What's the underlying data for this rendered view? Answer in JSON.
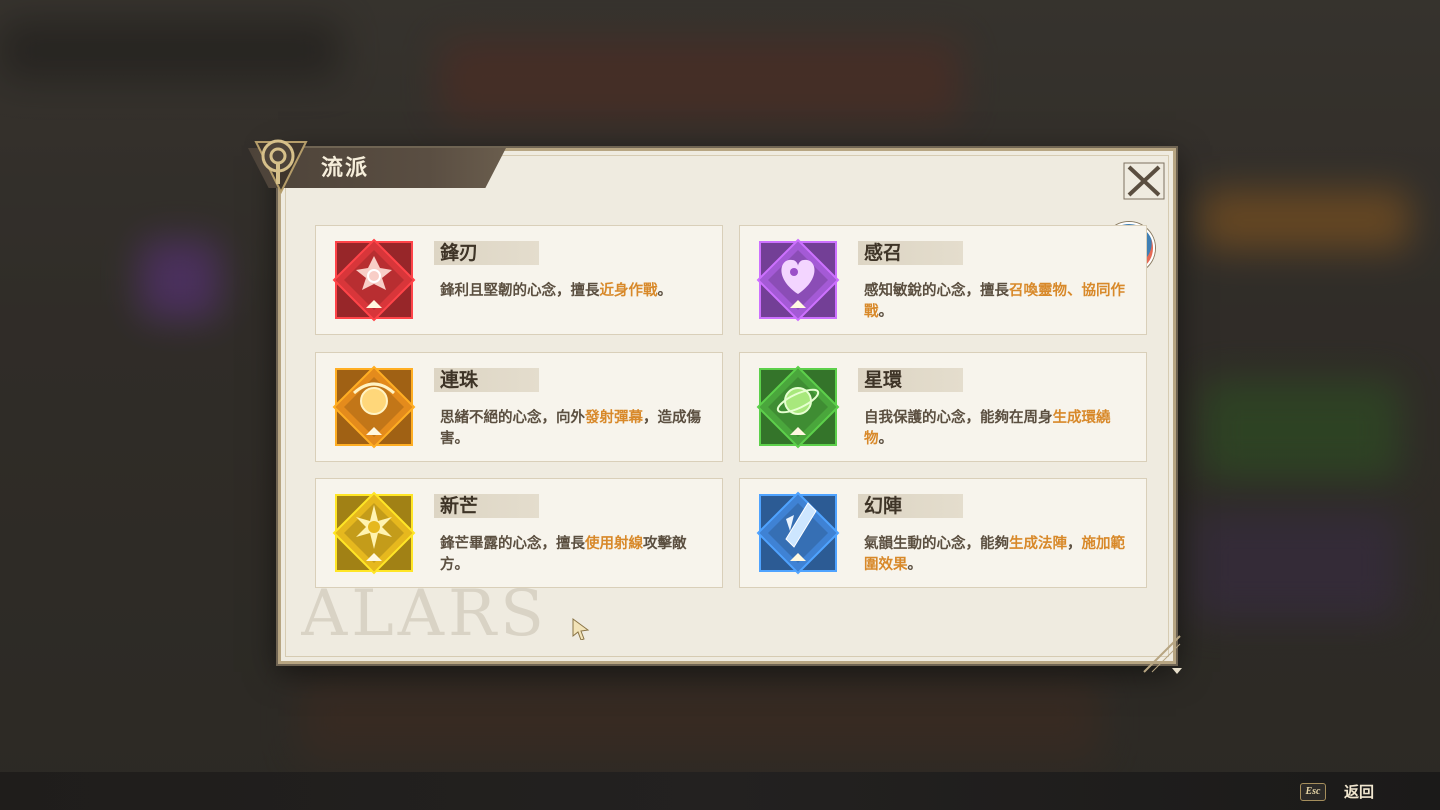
{
  "panel": {
    "title": "流派",
    "close_label": "X"
  },
  "cards": [
    {
      "name": "鋒刃",
      "icon": "blade-crest-icon",
      "color": "#d8363a",
      "desc": [
        {
          "text": "鋒利且堅韌的心念，擅長",
          "hl": false
        },
        {
          "text": "近身作戰",
          "hl": true
        },
        {
          "text": "。",
          "hl": false
        }
      ]
    },
    {
      "name": "感召",
      "icon": "summon-heart-icon",
      "color": "#a45ad6",
      "desc": [
        {
          "text": "感知敏銳的心念，擅長",
          "hl": false
        },
        {
          "text": "召喚靈物、協同作戰",
          "hl": true
        },
        {
          "text": "。",
          "hl": false
        }
      ]
    },
    {
      "name": "連珠",
      "icon": "orb-barrage-icon",
      "color": "#e48b1c",
      "desc": [
        {
          "text": "思緒不絕的心念，向外",
          "hl": false
        },
        {
          "text": "發射彈幕",
          "hl": true
        },
        {
          "text": "，造成傷害。",
          "hl": false
        }
      ]
    },
    {
      "name": "星環",
      "icon": "planet-ring-icon",
      "color": "#4aa63c",
      "desc": [
        {
          "text": "自我保護的心念，能夠在周身",
          "hl": false
        },
        {
          "text": "生成環繞物",
          "hl": true
        },
        {
          "text": "。",
          "hl": false
        }
      ]
    },
    {
      "name": "新芒",
      "icon": "radiant-sun-icon",
      "color": "#e6b81e",
      "desc": [
        {
          "text": "鋒芒畢露的心念，擅長",
          "hl": false
        },
        {
          "text": "使用射線",
          "hl": true
        },
        {
          "text": "攻擊敵方。",
          "hl": false
        }
      ]
    },
    {
      "name": "幻陣",
      "icon": "crystal-array-icon",
      "color": "#3f82d4",
      "desc": [
        {
          "text": "氣韻生動的心念，能夠",
          "hl": false
        },
        {
          "text": "生成法陣",
          "hl": true
        },
        {
          "text": "，",
          "hl": false
        },
        {
          "text": "施加範圍效果",
          "hl": true
        },
        {
          "text": "。",
          "hl": false
        }
      ]
    }
  ],
  "footer": {
    "esc_key": "Esc",
    "back_label": "返回"
  },
  "colors": {
    "highlight": "#d8892a",
    "panel_bg": "#efebe0",
    "title_tab_bg": "#5a4e42"
  }
}
